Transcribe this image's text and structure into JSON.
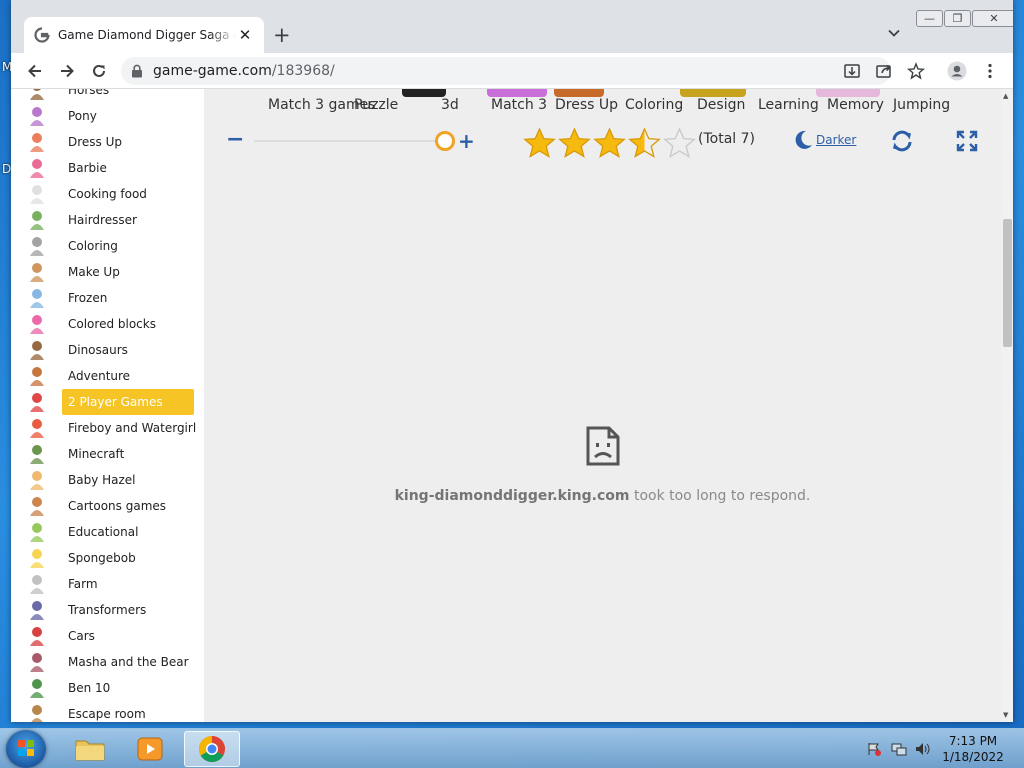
{
  "desktop": {
    "letters": [
      "M",
      "D"
    ]
  },
  "browser": {
    "tab_title": "Game Diamond Digger Saga online",
    "tab_close": "✕",
    "new_tab": "+",
    "url_domain": "game-game.com",
    "url_path": "/183968/",
    "window_buttons": {
      "minimize": "—",
      "maximize": "❐",
      "close": "✕"
    }
  },
  "sidebar": {
    "items": [
      {
        "label": "Horses",
        "icon": "horse-icon"
      },
      {
        "label": "Pony",
        "icon": "pony-icon"
      },
      {
        "label": "Dress Up",
        "icon": "dress-up-icon"
      },
      {
        "label": "Barbie",
        "icon": "barbie-icon"
      },
      {
        "label": "Cooking food",
        "icon": "chef-icon"
      },
      {
        "label": "Hairdresser",
        "icon": "scissors-icon"
      },
      {
        "label": "Coloring",
        "icon": "coloring-icon"
      },
      {
        "label": "Make Up",
        "icon": "makeup-icon"
      },
      {
        "label": "Frozen",
        "icon": "frozen-icon"
      },
      {
        "label": "Colored blocks",
        "icon": "blocks-icon"
      },
      {
        "label": "Dinosaurs",
        "icon": "dinosaur-icon"
      },
      {
        "label": "Adventure",
        "icon": "adventure-icon"
      },
      {
        "label": "2 Player Games",
        "icon": "two-player-icon",
        "active": true
      },
      {
        "label": "Fireboy and Watergirl",
        "icon": "fireboy-icon"
      },
      {
        "label": "Minecraft",
        "icon": "minecraft-icon"
      },
      {
        "label": "Baby Hazel",
        "icon": "baby-icon"
      },
      {
        "label": "Cartoons games",
        "icon": "cartoon-icon"
      },
      {
        "label": "Educational",
        "icon": "educational-icon"
      },
      {
        "label": "Spongebob",
        "icon": "spongebob-icon"
      },
      {
        "label": "Farm",
        "icon": "sheep-icon"
      },
      {
        "label": "Transformers",
        "icon": "robot-icon"
      },
      {
        "label": "Cars",
        "icon": "car-icon"
      },
      {
        "label": "Masha and the Bear",
        "icon": "masha-icon"
      },
      {
        "label": "Ben 10",
        "icon": "ben10-icon"
      },
      {
        "label": "Escape room",
        "icon": "door-icon"
      }
    ]
  },
  "categories": [
    {
      "label": "Match 3 games"
    },
    {
      "label": "Puzzle"
    },
    {
      "label": "3d"
    },
    {
      "label": "Match 3"
    },
    {
      "label": "Dress Up"
    },
    {
      "label": "Coloring"
    },
    {
      "label": "Design"
    },
    {
      "label": "Learning"
    },
    {
      "label": "Memory"
    },
    {
      "label": "Jumping"
    }
  ],
  "controls": {
    "minus": "−",
    "plus": "+",
    "rating": 3.5,
    "rating_max": 5,
    "total": "(Total 7)",
    "darker": "Darker",
    "zoom_level": 1.0
  },
  "error": {
    "host": "king-diamonddigger.king.com",
    "message": " took too long to respond."
  },
  "taskbar": {
    "time": "7:13 PM",
    "date": "1/18/2022",
    "accent": "#1f5fa8"
  }
}
